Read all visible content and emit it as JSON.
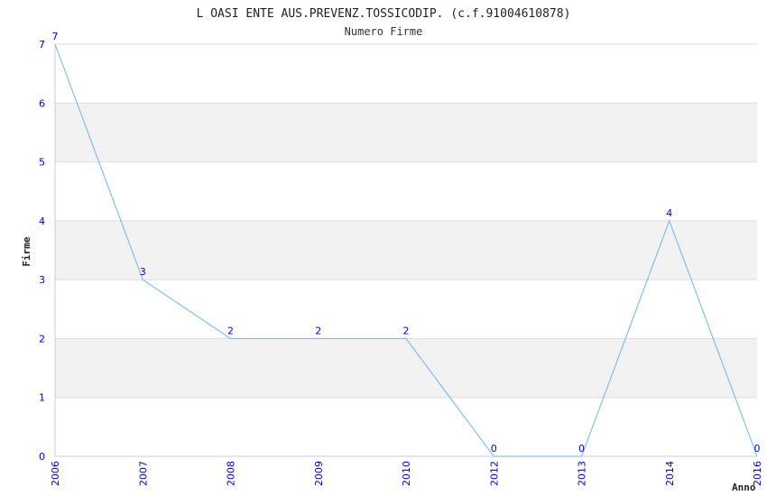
{
  "chart_data": {
    "type": "line",
    "title": "L OASI ENTE AUS.PREVENZ.TOSSICODIP. (c.f.91004610878)",
    "subtitle": "Numero Firme",
    "xlabel": "Anno",
    "ylabel": "Firme",
    "categories": [
      "2006",
      "2007",
      "2008",
      "2009",
      "2010",
      "2012",
      "2013",
      "2014",
      "2016"
    ],
    "series": [
      {
        "values": [
          7,
          3,
          2,
          2,
          2,
          0,
          0,
          4,
          0
        ]
      }
    ],
    "ylim": [
      0,
      7
    ],
    "yticks": [
      0,
      1,
      2,
      3,
      4,
      5,
      6,
      7
    ],
    "grid": true,
    "colors": {
      "line": "#6fb4ec",
      "tick_label": "#0000cc",
      "band": "#f2f2f2",
      "grid": "#dddddd"
    }
  }
}
